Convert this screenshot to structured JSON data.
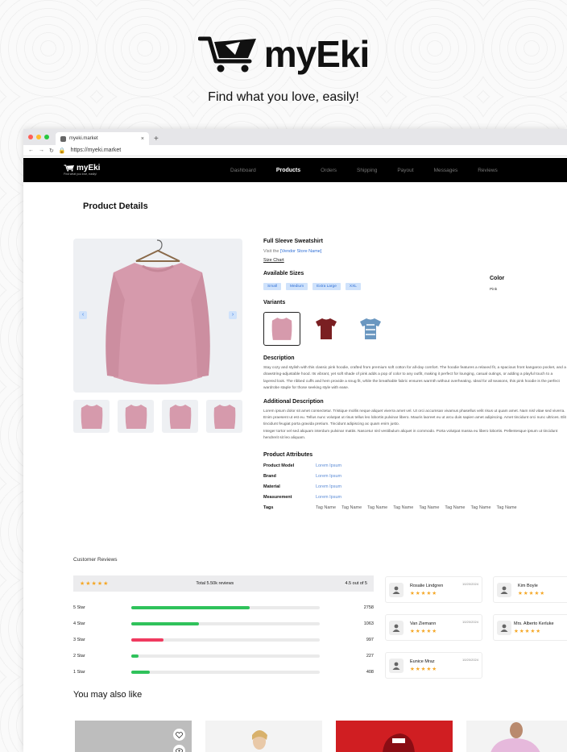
{
  "hero": {
    "brand": "myEki",
    "tagline": "Find what you love, easily!"
  },
  "browser": {
    "tab_title": "myeki.market",
    "tab_close": "×",
    "new_tab": "+",
    "url": "https://myeki.market"
  },
  "nav": {
    "brand": "myEki",
    "slogan": "Find what you love, easily!",
    "items": [
      "Dashboard",
      "Products",
      "Orders",
      "Shipping",
      "Payout",
      "Messages",
      "Reviews"
    ],
    "active": "Products"
  },
  "page": {
    "title": "Product Details"
  },
  "product": {
    "name": "Full Sleeve Sweatshirt",
    "visit_prefix": "Visit the ",
    "vendor_link": "[Vendor Store Name]",
    "size_chart": "Size Chart",
    "sizes_heading": "Available Sizes",
    "sizes": [
      "Small",
      "Medium",
      "Extra Large",
      "XXL"
    ],
    "color_heading": "Color",
    "color_value": "Pink",
    "variants_heading": "Variants",
    "description_heading": "Description",
    "description": "Stay cozy and stylish with this classic pink hoodie, crafted from premium soft cotton for all-day comfort. The hoodie features a relaxed fit, a spacious front kangaroo pocket, and a drawstring-adjustable hood. Its vibrant, yet soft shade of pink adds a pop of color to any outfit, making it perfect for lounging, casual outings, or adding a playful touch to a layered look. The ribbed cuffs and hem provide a snug fit, while the breathable fabric ensures warmth without overheating. Ideal for all seasons, this pink hoodie is the perfect wardrobe staple for those seeking style with ease.",
    "additional_heading": "Additional Description",
    "additional_1": "Lorem ipsum dolor sit amet consectetur. Tristique mollis neque aliquet viverra amet vel. Ut orci accumsan vivamus phasellus velit risus ut quam amet. Nam nisl vitae sed viverra. Enim praesent ut est eu. Tellus nunc volutpat ut risus tellus leo lobortis pulvinar libero. Mauris laoreet eu ut arcu duis sapien amet adipiscing. Amet tincidunt orci nunc ultrices. Elit tincidunt feugiat porta gravida pretium. Tincidunt adipiscing ac quam enim justo.",
    "additional_2": "Integer tortor vel sed aliquam interdum pulvinar mattis. Nascetur nisl vestibulum aliquet in commodo. Porta volutpat massa eu libero lobortis. Pellentesque ipsum ut tincidunt hendrerit sit leo aliquam.",
    "attributes_heading": "Product Attributes",
    "attributes": [
      {
        "key": "Product Model",
        "value": "Lorem Ipsum"
      },
      {
        "key": "Brand",
        "value": "Lorem Ipsum"
      },
      {
        "key": "Material",
        "value": "Lorem Ipsum"
      },
      {
        "key": "Measurement",
        "value": "Lorem Ipsum"
      }
    ],
    "tags_label": "Tags",
    "tags": [
      "Tag Name",
      "Tag Name",
      "Tag Name",
      "Tag Name",
      "Tag Name",
      "Tag Name",
      "Tag Name",
      "Tag Name"
    ],
    "colors": {
      "pink": "#d69aac",
      "maroon": "#7a1f22",
      "blue": "#6a97c0"
    }
  },
  "reviews": {
    "title": "Customer Reviews",
    "stars": "★★★★★",
    "total": "Total 5.50k reviews",
    "score": "4.5 out of 5",
    "bars": [
      {
        "label": "5 Star",
        "count": "2758",
        "fraction": 0.63,
        "color": "#2fc25b"
      },
      {
        "label": "4 Star",
        "count": "1063",
        "fraction": 0.36,
        "color": "#2fc25b"
      },
      {
        "label": "3 Star",
        "count": "997",
        "fraction": 0.17,
        "color": "#f03a5f"
      },
      {
        "label": "2 Star",
        "count": "227",
        "fraction": 0.04,
        "color": "#2fc25b"
      },
      {
        "label": "1 Star",
        "count": "408",
        "fraction": 0.1,
        "color": "#2fc25b"
      }
    ],
    "cards": [
      {
        "name": "Rosalie Lindgren",
        "date": "10/20/2024",
        "stars": "★★★★★"
      },
      {
        "name": "Kim Boyle",
        "date": "",
        "stars": "★★★★★"
      },
      {
        "name": "Van Ziemann",
        "date": "10/20/2024",
        "stars": "★★★★★"
      },
      {
        "name": "Mrs. Alberto Kerluke",
        "date": "",
        "stars": "★★★★★"
      },
      {
        "name": "Eunice Mraz",
        "date": "10/20/2024",
        "stars": "★★★★★"
      }
    ]
  },
  "also": {
    "title": "You may also like"
  }
}
